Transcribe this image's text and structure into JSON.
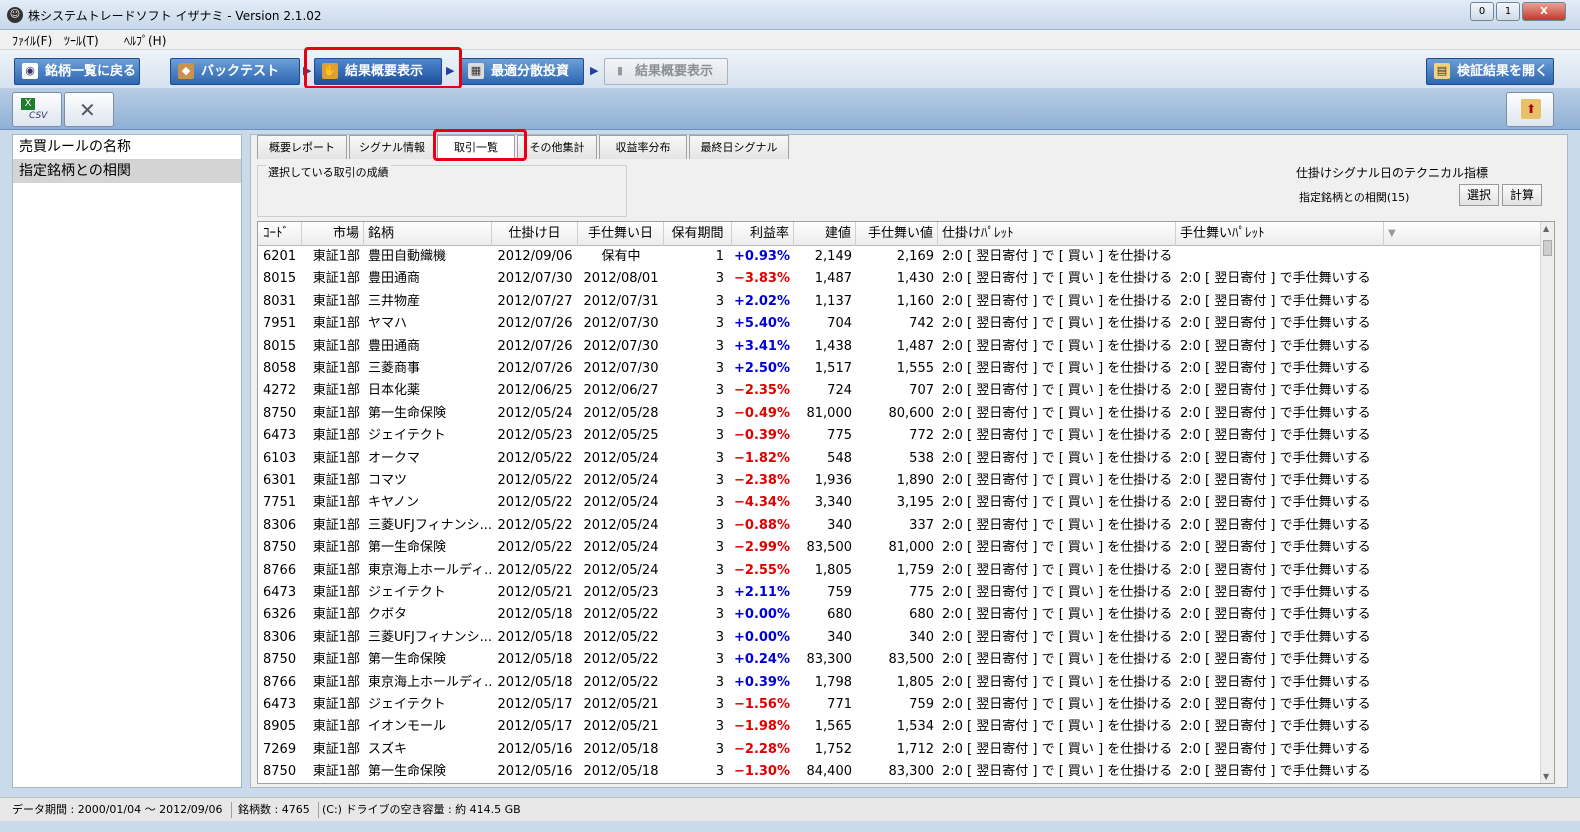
{
  "window": {
    "title": "株システムトレードソフト イザナミ - Version 2.1.02",
    "min": "0",
    "max": "1",
    "close": "X"
  },
  "menu": [
    "ﾌｧｲﾙ(F)",
    "ﾂｰﾙ(T)",
    "ﾍﾙﾌﾟ(H)"
  ],
  "nav": {
    "back": "銘柄一覧に戻る",
    "backtest": "バックテスト",
    "summary": "結果概要表示",
    "optimal": "最適分散投資",
    "summary2": "結果概要表示",
    "open": "検証結果を開く"
  },
  "toolbar": {
    "csv_label": "CSV"
  },
  "left_panel": {
    "header": "売買ルールの名称",
    "items": [
      "指定銘柄との相関"
    ]
  },
  "tabs": [
    "概要レポート",
    "シグナル情報",
    "取引一覧",
    "その他集計",
    "収益率分布",
    "最終日シグナル"
  ],
  "selected_group": {
    "label": "選択している取引の成績"
  },
  "tech": {
    "title": "仕掛けシグナル日のテクニカル指標",
    "value": "指定銘柄との相関(15)",
    "select_btn": "選択",
    "calc_btn": "計算"
  },
  "table": {
    "headers": [
      "ｺｰﾄﾞ",
      "市場",
      "銘柄",
      "仕掛け日",
      "手仕舞い日",
      "保有期間",
      "利益率",
      "建値",
      "手仕舞い値",
      "仕掛けﾊﾟﾚｯﾄ",
      "手仕舞いﾊﾟﾚｯﾄ"
    ],
    "rows": [
      [
        "6201",
        "東証1部",
        "豊田自動織機",
        "2012/09/06",
        "保有中",
        "1",
        "+0.93%",
        "2,149",
        "2,169",
        "2:0 [ 翌日寄付 ] で [ 買い ] を仕掛ける",
        ""
      ],
      [
        "8015",
        "東証1部",
        "豊田通商",
        "2012/07/30",
        "2012/08/01",
        "3",
        "−3.83%",
        "1,487",
        "1,430",
        "2:0 [ 翌日寄付 ] で [ 買い ] を仕掛ける",
        "2:0 [ 翌日寄付 ] で手仕舞いする"
      ],
      [
        "8031",
        "東証1部",
        "三井物産",
        "2012/07/27",
        "2012/07/31",
        "3",
        "+2.02%",
        "1,137",
        "1,160",
        "2:0 [ 翌日寄付 ] で [ 買い ] を仕掛ける",
        "2:0 [ 翌日寄付 ] で手仕舞いする"
      ],
      [
        "7951",
        "東証1部",
        "ヤマハ",
        "2012/07/26",
        "2012/07/30",
        "3",
        "+5.40%",
        "704",
        "742",
        "2:0 [ 翌日寄付 ] で [ 買い ] を仕掛ける",
        "2:0 [ 翌日寄付 ] で手仕舞いする"
      ],
      [
        "8015",
        "東証1部",
        "豊田通商",
        "2012/07/26",
        "2012/07/30",
        "3",
        "+3.41%",
        "1,438",
        "1,487",
        "2:0 [ 翌日寄付 ] で [ 買い ] を仕掛ける",
        "2:0 [ 翌日寄付 ] で手仕舞いする"
      ],
      [
        "8058",
        "東証1部",
        "三菱商事",
        "2012/07/26",
        "2012/07/30",
        "3",
        "+2.50%",
        "1,517",
        "1,555",
        "2:0 [ 翌日寄付 ] で [ 買い ] を仕掛ける",
        "2:0 [ 翌日寄付 ] で手仕舞いする"
      ],
      [
        "4272",
        "東証1部",
        "日本化薬",
        "2012/06/25",
        "2012/06/27",
        "3",
        "−2.35%",
        "724",
        "707",
        "2:0 [ 翌日寄付 ] で [ 買い ] を仕掛ける",
        "2:0 [ 翌日寄付 ] で手仕舞いする"
      ],
      [
        "8750",
        "東証1部",
        "第一生命保険",
        "2012/05/24",
        "2012/05/28",
        "3",
        "−0.49%",
        "81,000",
        "80,600",
        "2:0 [ 翌日寄付 ] で [ 買い ] を仕掛ける",
        "2:0 [ 翌日寄付 ] で手仕舞いする"
      ],
      [
        "6473",
        "東証1部",
        "ジェイテクト",
        "2012/05/23",
        "2012/05/25",
        "3",
        "−0.39%",
        "775",
        "772",
        "2:0 [ 翌日寄付 ] で [ 買い ] を仕掛ける",
        "2:0 [ 翌日寄付 ] で手仕舞いする"
      ],
      [
        "6103",
        "東証1部",
        "オークマ",
        "2012/05/22",
        "2012/05/24",
        "3",
        "−1.82%",
        "548",
        "538",
        "2:0 [ 翌日寄付 ] で [ 買い ] を仕掛ける",
        "2:0 [ 翌日寄付 ] で手仕舞いする"
      ],
      [
        "6301",
        "東証1部",
        "コマツ",
        "2012/05/22",
        "2012/05/24",
        "3",
        "−2.38%",
        "1,936",
        "1,890",
        "2:0 [ 翌日寄付 ] で [ 買い ] を仕掛ける",
        "2:0 [ 翌日寄付 ] で手仕舞いする"
      ],
      [
        "7751",
        "東証1部",
        "キヤノン",
        "2012/05/22",
        "2012/05/24",
        "3",
        "−4.34%",
        "3,340",
        "3,195",
        "2:0 [ 翌日寄付 ] で [ 買い ] を仕掛ける",
        "2:0 [ 翌日寄付 ] で手仕舞いする"
      ],
      [
        "8306",
        "東証1部",
        "三菱UFJフィナンシ...",
        "2012/05/22",
        "2012/05/24",
        "3",
        "−0.88%",
        "340",
        "337",
        "2:0 [ 翌日寄付 ] で [ 買い ] を仕掛ける",
        "2:0 [ 翌日寄付 ] で手仕舞いする"
      ],
      [
        "8750",
        "東証1部",
        "第一生命保険",
        "2012/05/22",
        "2012/05/24",
        "3",
        "−2.99%",
        "83,500",
        "81,000",
        "2:0 [ 翌日寄付 ] で [ 買い ] を仕掛ける",
        "2:0 [ 翌日寄付 ] で手仕舞いする"
      ],
      [
        "8766",
        "東証1部",
        "東京海上ホールディ...",
        "2012/05/22",
        "2012/05/24",
        "3",
        "−2.55%",
        "1,805",
        "1,759",
        "2:0 [ 翌日寄付 ] で [ 買い ] を仕掛ける",
        "2:0 [ 翌日寄付 ] で手仕舞いする"
      ],
      [
        "6473",
        "東証1部",
        "ジェイテクト",
        "2012/05/21",
        "2012/05/23",
        "3",
        "+2.11%",
        "759",
        "775",
        "2:0 [ 翌日寄付 ] で [ 買い ] を仕掛ける",
        "2:0 [ 翌日寄付 ] で手仕舞いする"
      ],
      [
        "6326",
        "東証1部",
        "クボタ",
        "2012/05/18",
        "2012/05/22",
        "3",
        "+0.00%",
        "680",
        "680",
        "2:0 [ 翌日寄付 ] で [ 買い ] を仕掛ける",
        "2:0 [ 翌日寄付 ] で手仕舞いする"
      ],
      [
        "8306",
        "東証1部",
        "三菱UFJフィナンシ...",
        "2012/05/18",
        "2012/05/22",
        "3",
        "+0.00%",
        "340",
        "340",
        "2:0 [ 翌日寄付 ] で [ 買い ] を仕掛ける",
        "2:0 [ 翌日寄付 ] で手仕舞いする"
      ],
      [
        "8750",
        "東証1部",
        "第一生命保険",
        "2012/05/18",
        "2012/05/22",
        "3",
        "+0.24%",
        "83,300",
        "83,500",
        "2:0 [ 翌日寄付 ] で [ 買い ] を仕掛ける",
        "2:0 [ 翌日寄付 ] で手仕舞いする"
      ],
      [
        "8766",
        "東証1部",
        "東京海上ホールディ...",
        "2012/05/18",
        "2012/05/22",
        "3",
        "+0.39%",
        "1,798",
        "1,805",
        "2:0 [ 翌日寄付 ] で [ 買い ] を仕掛ける",
        "2:0 [ 翌日寄付 ] で手仕舞いする"
      ],
      [
        "6473",
        "東証1部",
        "ジェイテクト",
        "2012/05/17",
        "2012/05/21",
        "3",
        "−1.56%",
        "771",
        "759",
        "2:0 [ 翌日寄付 ] で [ 買い ] を仕掛ける",
        "2:0 [ 翌日寄付 ] で手仕舞いする"
      ],
      [
        "8905",
        "東証1部",
        "イオンモール",
        "2012/05/17",
        "2012/05/21",
        "3",
        "−1.98%",
        "1,565",
        "1,534",
        "2:0 [ 翌日寄付 ] で [ 買い ] を仕掛ける",
        "2:0 [ 翌日寄付 ] で手仕舞いする"
      ],
      [
        "7269",
        "東証1部",
        "スズキ",
        "2012/05/16",
        "2012/05/18",
        "3",
        "−2.28%",
        "1,752",
        "1,712",
        "2:0 [ 翌日寄付 ] で [ 買い ] を仕掛ける",
        "2:0 [ 翌日寄付 ] で手仕舞いする"
      ],
      [
        "8750",
        "東証1部",
        "第一生命保険",
        "2012/05/16",
        "2012/05/18",
        "3",
        "−1.30%",
        "84,400",
        "83,300",
        "2:0 [ 翌日寄付 ] で [ 買い ] を仕掛ける",
        "2:0 [ 翌日寄付 ] で手仕舞いする"
      ]
    ]
  },
  "status": {
    "period": "データ期間 : 2000/01/04 〜 2012/09/06",
    "count": "銘柄数 : 4765",
    "disk": "(C:) ドライブの空き容量 : 約 414.5 GB"
  },
  "colors": {
    "positive": "#0000d8",
    "negative": "#e00000",
    "highlight": "#e60012"
  }
}
